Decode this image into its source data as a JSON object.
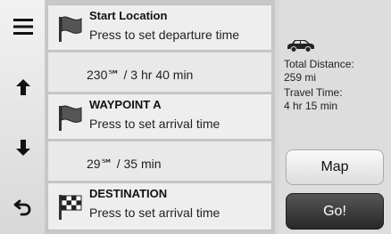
{
  "left_toolbar": {
    "menu_icon": "menu-icon",
    "up_icon": "arrow-up-icon",
    "down_icon": "arrow-down-icon",
    "back_icon": "back-icon"
  },
  "route": {
    "stops": [
      {
        "title": "Start Location",
        "subtitle": "Press to set departure time",
        "icon": "start-flag-icon"
      },
      {
        "title": "WAYPOINT A",
        "subtitle": "Press to set arrival time",
        "icon": "waypoint-flag-icon"
      },
      {
        "title": "DESTINATION",
        "subtitle": "Press to set arrival time",
        "icon": "destination-flag-icon"
      }
    ],
    "legs": [
      {
        "text": "230℠ / 3 hr 40 min"
      },
      {
        "text": "29℠ / 35 min"
      }
    ]
  },
  "summary": {
    "car_icon": "car-icon",
    "total_distance_label": "Total Distance:",
    "total_distance_value": "259 mi",
    "travel_time_label": "Travel Time:",
    "travel_time_value": "4 hr 15 min"
  },
  "buttons": {
    "map_label": "Map",
    "go_label": "Go!"
  }
}
